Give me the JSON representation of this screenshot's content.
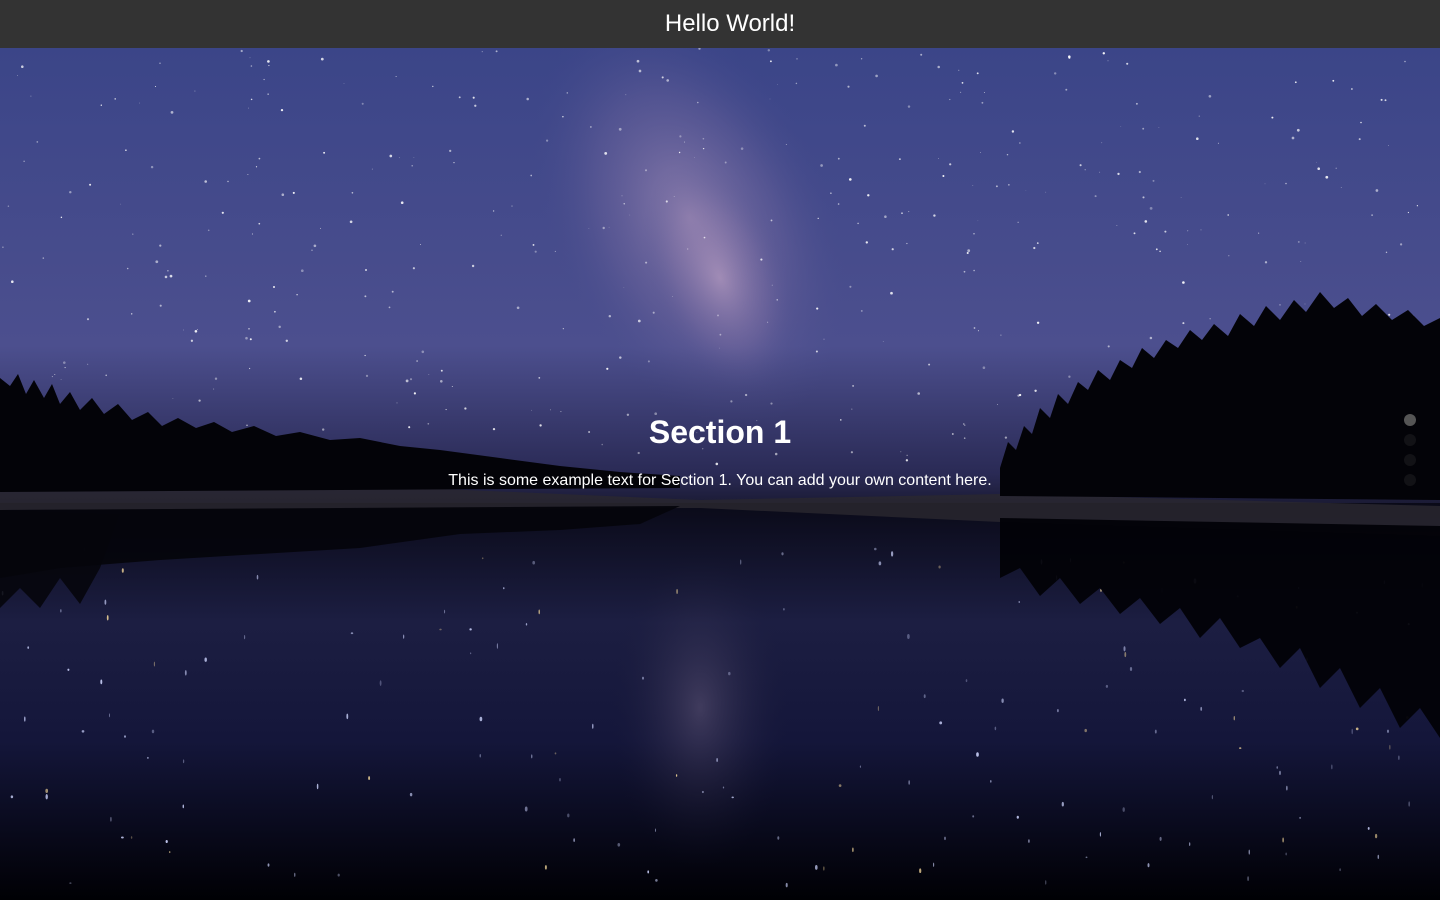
{
  "header": {
    "title": "Hello World!"
  },
  "section": {
    "heading": "Section 1",
    "text": "This is some example text for Section 1. You can add your own content here."
  },
  "nav_dots": {
    "count": 4,
    "active_index": 0
  },
  "colors": {
    "header_bg": "#333333",
    "header_text": "#ffffff",
    "sky_top": "#3f4a8a",
    "sky_mid": "#6b5f9a",
    "water_dark": "#05050f",
    "active_dot": "#555555"
  }
}
